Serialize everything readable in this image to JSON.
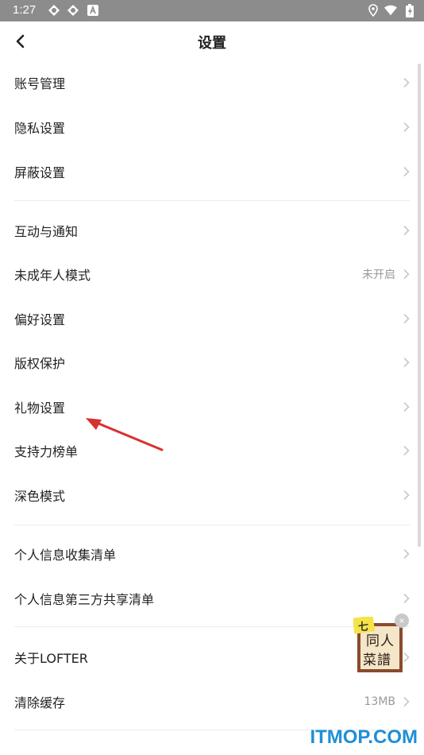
{
  "status_bar": {
    "time": "1:27",
    "icons_left": [
      "app-notification-icon",
      "app-notification-icon",
      "text-a-icon"
    ],
    "icons_right": [
      "location-icon",
      "wifi-icon",
      "battery-charging-icon"
    ]
  },
  "header": {
    "title": "设置",
    "back_icon": "chevron-left-icon"
  },
  "settings": [
    {
      "label": "账号管理",
      "value": ""
    },
    {
      "label": "隐私设置",
      "value": ""
    },
    {
      "label": "屏蔽设置",
      "value": ""
    },
    {
      "label": "互动与通知",
      "value": ""
    },
    {
      "label": "未成年人模式",
      "value": "未开启"
    },
    {
      "label": "偏好设置",
      "value": ""
    },
    {
      "label": "版权保护",
      "value": ""
    },
    {
      "label": "礼物设置",
      "value": ""
    },
    {
      "label": "支持力榜单",
      "value": ""
    },
    {
      "label": "深色模式",
      "value": ""
    },
    {
      "label": "个人信息收集清单",
      "value": ""
    },
    {
      "label": "个人信息第三方共享清单",
      "value": ""
    },
    {
      "label": "关于LOFTER",
      "value": ""
    },
    {
      "label": "清除缓存",
      "value": "13MB"
    }
  ],
  "float_ad": {
    "text_top": "同人",
    "text_bottom": "菜譜",
    "close_label": "×"
  },
  "watermark": "ITMOP.COM",
  "colors": {
    "status_bar_bg": "#8c8c8c",
    "text_primary": "#222222",
    "text_secondary": "#999999",
    "divider": "#ececec",
    "annotation_arrow": "#d93030",
    "watermark": "#1e8fd6"
  }
}
